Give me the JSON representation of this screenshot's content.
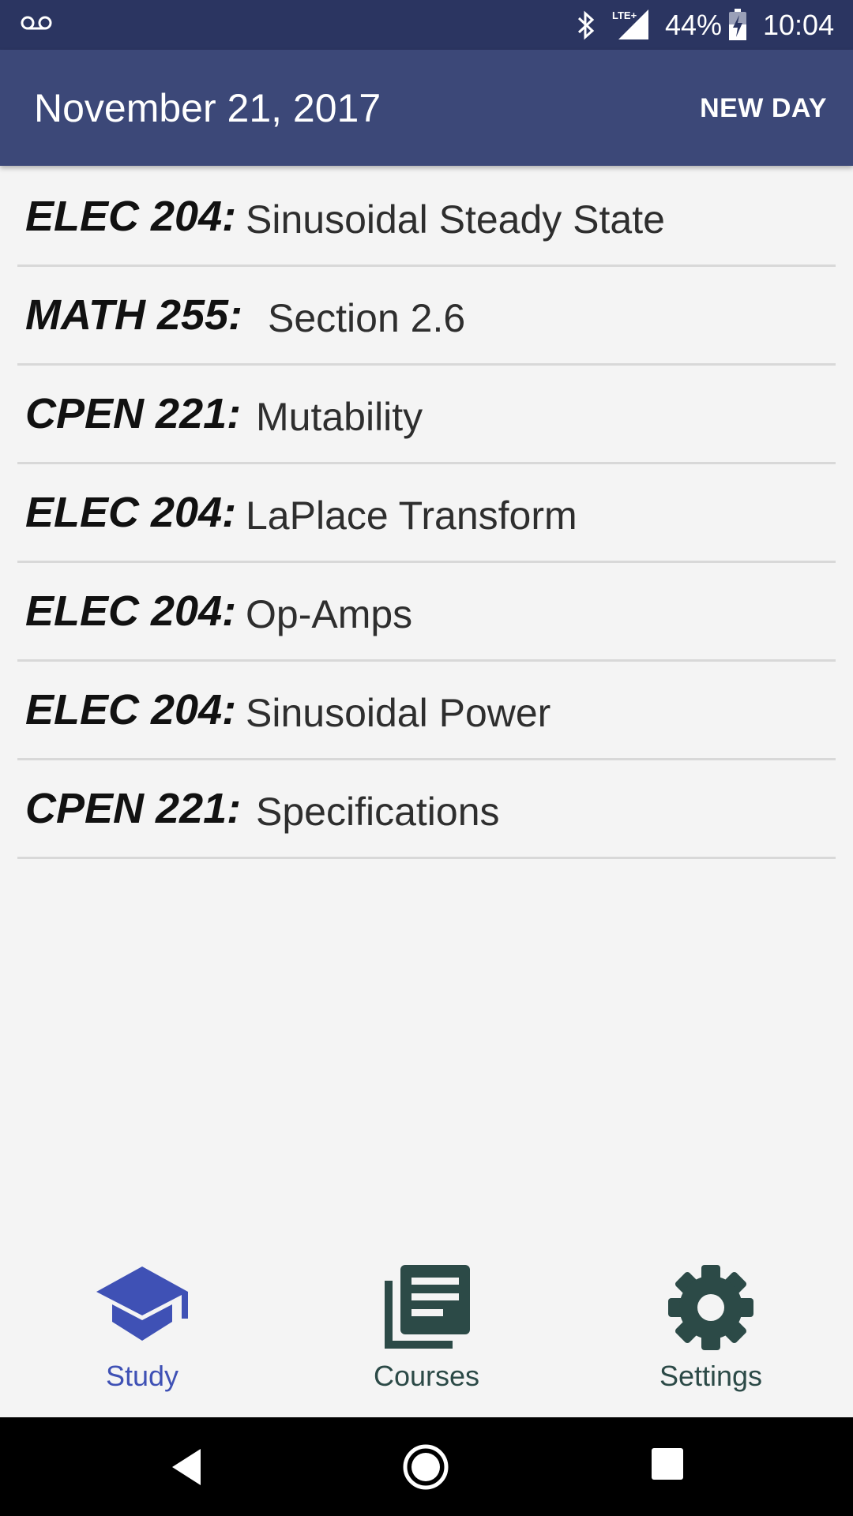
{
  "status_bar": {
    "battery": "44%",
    "time": "10:04",
    "icons": [
      "voicemail-icon",
      "bluetooth-icon",
      "lte-signal-icon",
      "battery-charging-icon"
    ]
  },
  "app_bar": {
    "date": "November 21, 2017",
    "action": "NEW DAY"
  },
  "items": [
    {
      "course": "ELEC 204:",
      "topic": "Sinusoidal Steady State"
    },
    {
      "course": "MATH 255:",
      "topic": "Section 2.6"
    },
    {
      "course": "CPEN 221:",
      "topic": "Mutability"
    },
    {
      "course": "ELEC 204:",
      "topic": "LaPlace Transform"
    },
    {
      "course": "ELEC 204:",
      "topic": "Op-Amps"
    },
    {
      "course": "ELEC 204:",
      "topic": "Sinusoidal Power"
    },
    {
      "course": "CPEN 221:",
      "topic": "Specifications"
    }
  ],
  "bottom_nav": {
    "study": "Study",
    "courses": "Courses",
    "settings": "Settings",
    "active": "study"
  },
  "colors": {
    "status_bar": "#2b3561",
    "app_bar": "#3c4878",
    "accent": "#3f51b5",
    "inactive_icon": "#2c4a47",
    "background": "#f4f4f4"
  }
}
